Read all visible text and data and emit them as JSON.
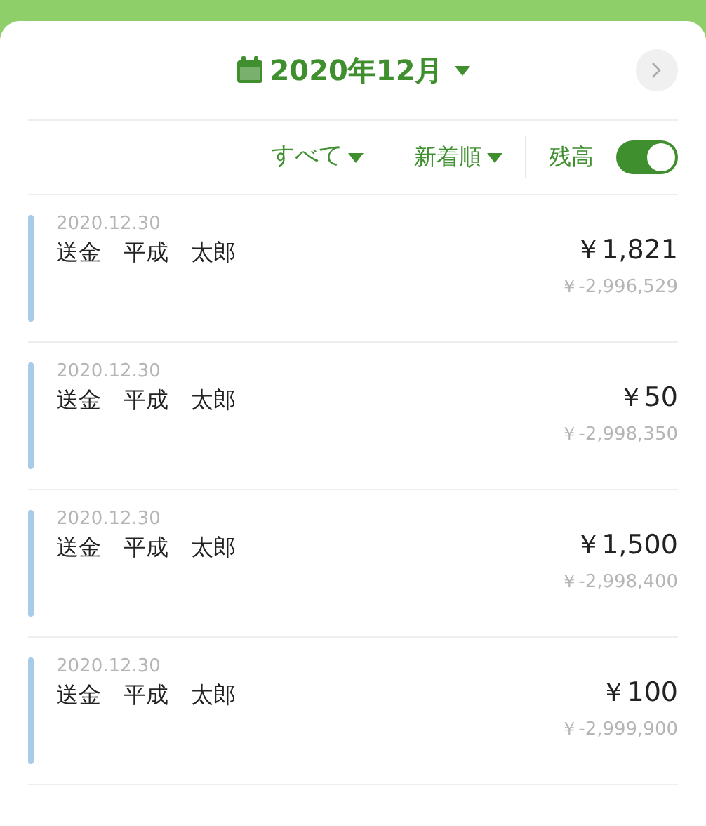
{
  "header": {
    "month": "2020年12月"
  },
  "filters": {
    "category": "すべて",
    "sort": "新着順",
    "balance_label": "残高",
    "balance_on": true
  },
  "transactions": [
    {
      "date": "2020.12.30",
      "name": "送金　平成　太郎",
      "amount": "￥1,821",
      "balance": "￥-2,996,529"
    },
    {
      "date": "2020.12.30",
      "name": "送金　平成　太郎",
      "amount": "￥50",
      "balance": "￥-2,998,350"
    },
    {
      "date": "2020.12.30",
      "name": "送金　平成　太郎",
      "amount": "￥1,500",
      "balance": "￥-2,998,400"
    },
    {
      "date": "2020.12.30",
      "name": "送金　平成　太郎",
      "amount": "￥100",
      "balance": "￥-2,999,900"
    }
  ]
}
